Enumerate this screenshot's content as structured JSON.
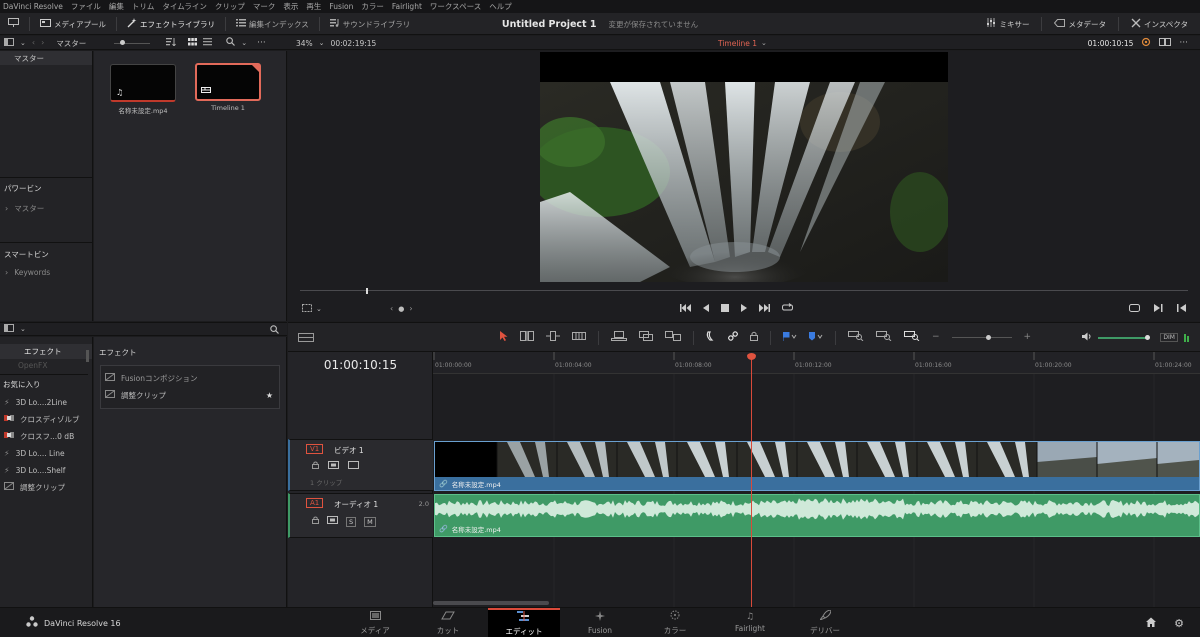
{
  "menubar": [
    "DaVinci Resolve",
    "ファイル",
    "編集",
    "トリム",
    "タイムライン",
    "クリップ",
    "マーク",
    "表示",
    "再生",
    "Fusion",
    "カラー",
    "Fairlight",
    "ワークスペース",
    "ヘルプ"
  ],
  "toolbar": {
    "media_pool": "メディアプール",
    "effects_library": "エフェクトライブラリ",
    "edit_index": "編集インデックス",
    "sound_library": "サウンドライブラリ",
    "mixer": "ミキサー",
    "metadata": "メタデータ",
    "inspector": "インスペクタ"
  },
  "project": {
    "title": "Untitled Project 1",
    "status": "変更が保存されていません"
  },
  "subbar": {
    "bin": "マスター",
    "zoom": "34%",
    "duration": "00:02:19:15",
    "timeline_name": "Timeline 1",
    "timecode": "01:00:10:15"
  },
  "bins": {
    "master": "マスター",
    "power_bins_title": "パワービン",
    "power_bins_master": "マスター",
    "smart_bins_title": "スマートビン",
    "keywords": "Keywords"
  },
  "clips": [
    {
      "name": "名称未設定.mp4",
      "icon": "music-note-icon"
    },
    {
      "name": "Timeline 1",
      "icon": "timeline-icon"
    }
  ],
  "effects": {
    "toolbox": "エフェクト",
    "openfx": "OpenFX",
    "list_title": "エフェクト",
    "fusion_composition": "Fusionコンポジション",
    "adjustment_clip": "調整クリップ",
    "favorites_title": "お気に入り",
    "favorites": [
      "3D Lo....2Line",
      "クロスディゾルブ",
      "クロスフ...0 dB",
      "3D Lo.... Line",
      "3D Lo....Shelf",
      "調整クリップ"
    ]
  },
  "timeline": {
    "timecode": "01:00:10:15",
    "ruler": [
      "01:00:00:00",
      "01:00:04:00",
      "01:00:08:00",
      "01:00:12:00",
      "01:00:16:00",
      "01:00:20:00",
      "01:00:24:00"
    ],
    "video_track": {
      "id": "V1",
      "name": "ビデオ 1",
      "clip_count": "1 クリップ",
      "clip_name": "名称未設定.mp4"
    },
    "audio_track": {
      "id": "A1",
      "name": "オーディオ 1",
      "level": "2.0",
      "solo": "S",
      "mute": "M",
      "clip_name": "名称未設定.mp4"
    },
    "audio_meter": "DIM"
  },
  "pages": {
    "brand": "DaVinci Resolve 16",
    "tabs": [
      "メディア",
      "カット",
      "エディット",
      "Fusion",
      "カラー",
      "Fairlight",
      "デリバー"
    ],
    "active": "エディット"
  },
  "colors": {
    "accent_red": "#d94a3a",
    "video_clip": "#3a6f9e",
    "audio_clip": "#3f9a66"
  }
}
